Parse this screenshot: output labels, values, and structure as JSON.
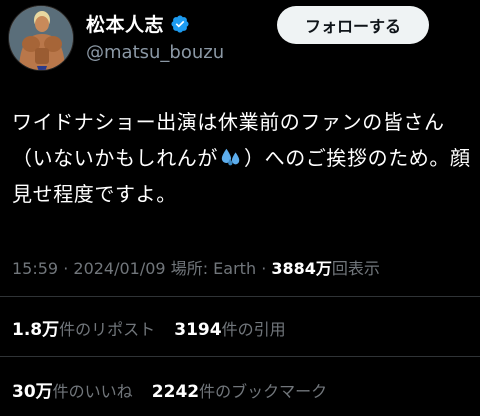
{
  "profile": {
    "display_name": "松本人志",
    "handle": "@matsu_bouzu",
    "verified": true,
    "follow_label": "フォローする"
  },
  "tweet": {
    "text_part1": "ワイドナショー出演は休業前のファンの皆さん（いないかもしれんが",
    "emoji": "sweat-droplets-emoji",
    "text_part2": "）へのご挨拶のため。顔見せ程度ですよ。"
  },
  "meta": {
    "time": "15:59",
    "date": "2024/01/09",
    "location": "場所: Earth",
    "views_count": "3884万",
    "views_label": "回表示",
    "separator": "·"
  },
  "stats": {
    "reposts_count": "1.8万",
    "reposts_label": "件のリポスト",
    "quotes_count": "3194",
    "quotes_label": "件の引用",
    "likes_count": "30万",
    "likes_label": "件のいいね",
    "bookmarks_count": "2242",
    "bookmarks_label": "件のブックマーク"
  },
  "colors": {
    "background": "#000000",
    "text": "#ffffff",
    "muted": "#71767b",
    "verified": "#1d9bf0",
    "button_bg": "#eff3f4"
  }
}
